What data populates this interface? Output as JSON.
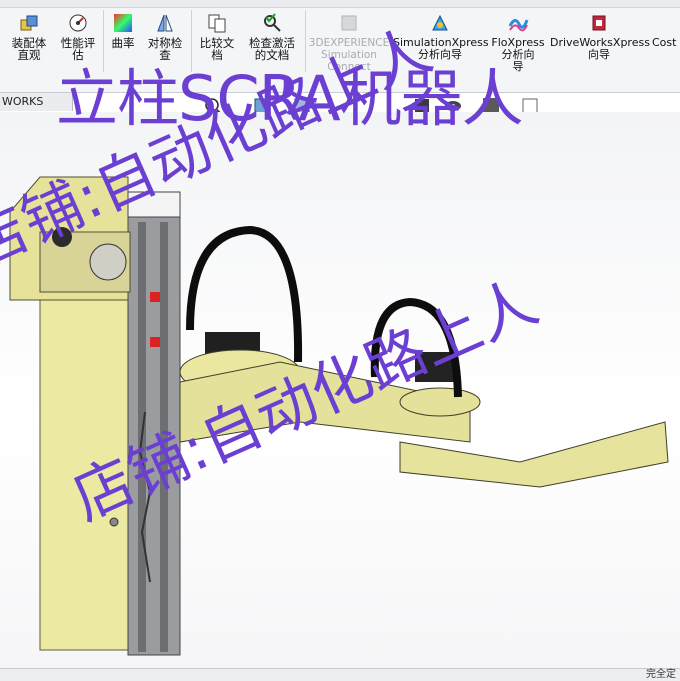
{
  "ribbon": {
    "buttons": [
      {
        "label": "装配体\n直观",
        "icon": "assembly-visual-icon"
      },
      {
        "label": "性能评\n估",
        "icon": "performance-eval-icon"
      },
      {
        "label": "曲率",
        "icon": "curvature-icon"
      },
      {
        "label": "对称检\n查",
        "icon": "symmetry-check-icon"
      },
      {
        "label": "比较文\n档",
        "icon": "compare-docs-icon"
      },
      {
        "label": "检查激活\n的文档",
        "icon": "check-active-doc-icon"
      },
      {
        "label": "3DEXPERIENCE\nSimulation\nConnect",
        "icon": "3dexperience-icon"
      },
      {
        "label": "SimulationXpress\n分析向导",
        "icon": "simulationxpress-icon"
      },
      {
        "label": "FloXpress\n分析向\n导",
        "icon": "floxpress-icon"
      },
      {
        "label": "DriveWorksXpress\n向导",
        "icon": "driveworksxpress-icon"
      },
      {
        "label": "Cost",
        "icon": "costing-icon"
      }
    ]
  },
  "tab": {
    "label": "WORKS MBD"
  },
  "status": {
    "text": "完全定"
  },
  "watermarks": {
    "title": "立柱SCRA机器人",
    "shop1": "店铺:自动化路上人",
    "shop2": "店铺:自动化路上人"
  },
  "colors": {
    "watermark": "#6a3fd2",
    "part_yellow": "#e9e79a",
    "rail_gray": "#8a8c8f",
    "motor_black": "#1b1b1b",
    "cable_black": "#0d0d0d"
  }
}
